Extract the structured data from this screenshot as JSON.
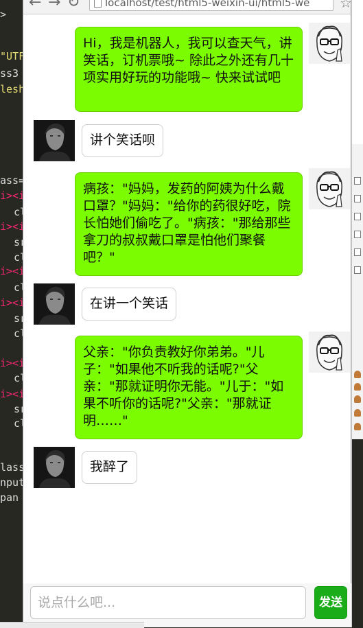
{
  "browser": {
    "url": "localhost/test/html5-weixin-ui/html5-we"
  },
  "editor": {
    "lines": [
      ">",
      "\"UTF",
      "ss3",
      "lesh",
      "ass=",
      "i><i",
      "cl",
      "i><i",
      "sr",
      "cl",
      "i><i",
      "cl",
      "i><i",
      "sr",
      "cl",
      "i><i",
      "cl",
      "i><i",
      "sr",
      "cl",
      "lass",
      "nput",
      "pan"
    ]
  },
  "chat": {
    "messages": [
      {
        "from": "bot",
        "text": "Hi，我是机器人，我可以查天气，讲笑话，订机票哦~ 除此之外还有几十项实用好玩的功能哦~ 快来试试吧"
      },
      {
        "from": "user",
        "text": "讲个笑话呗"
      },
      {
        "from": "bot",
        "text": "病孩：\"妈妈，发药的阿姨为什么戴口罩？\"妈妈：\"给你的药很好吃，院长怕她们偷吃了。\"病孩：\"那给那些拿刀的叔叔戴口罩是怕他们聚餐吧？\""
      },
      {
        "from": "user",
        "text": "在讲一个笑话"
      },
      {
        "from": "bot",
        "text": "父亲：\"你负责教好你弟弟。\"儿子：\"如果他不听我的话呢?\"父亲：\"那就证明你无能。\"儿于：\"如果不听你的话呢?\"父亲：\"那就证明……\""
      },
      {
        "from": "user",
        "text": "我醉了"
      }
    ]
  },
  "input": {
    "placeholder": "说点什么吧...",
    "send_label": "发送"
  },
  "colors": {
    "bot_bubble": "#7cfc00",
    "send_button": "#1aad19"
  }
}
